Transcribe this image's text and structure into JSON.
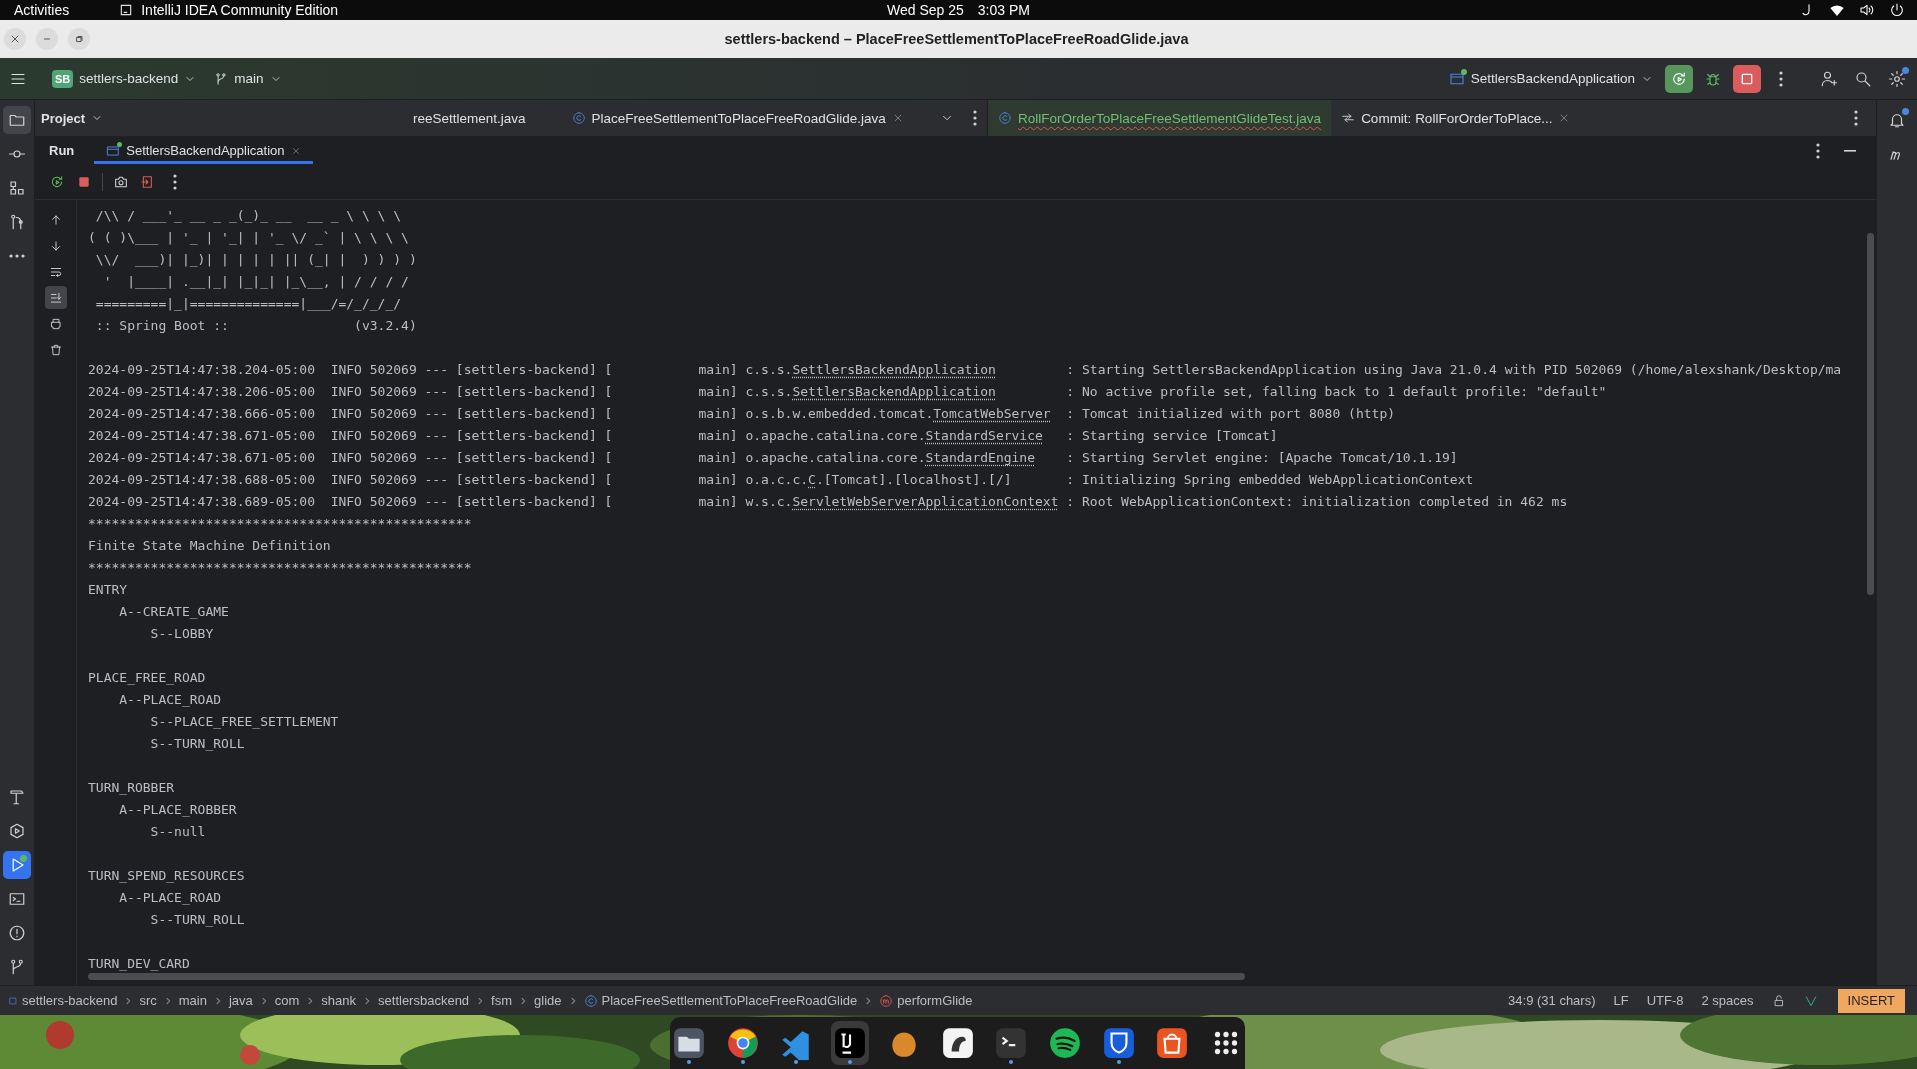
{
  "topbar": {
    "activities": "Activities",
    "app": "IntelliJ IDEA Community Edition",
    "date": "Wed Sep 25",
    "time": "3:03 PM"
  },
  "window": {
    "title": "settlers-backend – PlaceFreeSettlementToPlaceFreeRoadGlide.java"
  },
  "toolbar": {
    "project_badge": "SB",
    "project": "settlers-backend",
    "branch": "main",
    "run_config": "SettlersBackendApplication",
    "run_config_running": true,
    "settings_badge": true
  },
  "left_stripe": [
    {
      "kind": "folder",
      "selected": true,
      "focused": false,
      "running": false
    },
    {
      "kind": "commit",
      "selected": false,
      "focused": false,
      "running": false
    },
    {
      "kind": "structure",
      "selected": false,
      "focused": false,
      "running": false
    },
    {
      "kind": "pullreq",
      "selected": false,
      "focused": false,
      "running": false
    },
    {
      "kind": "more",
      "selected": false,
      "focused": false,
      "running": false
    },
    {
      "kind": "hammer",
      "selected": false,
      "focused": false,
      "running": false
    },
    {
      "kind": "services",
      "selected": false,
      "focused": false,
      "running": false
    },
    {
      "kind": "run",
      "selected": true,
      "focused": true,
      "running": true
    },
    {
      "kind": "terminal",
      "selected": false,
      "focused": false,
      "running": false
    },
    {
      "kind": "problems",
      "selected": false,
      "focused": false,
      "running": false
    },
    {
      "kind": "git",
      "selected": false,
      "focused": false,
      "running": false
    }
  ],
  "right_stripe": {
    "notifications_badge": true
  },
  "project_panel": {
    "title": "Project"
  },
  "editor_tabs": [
    {
      "label": "reeSettlement.java",
      "kind": "plain",
      "selected": false,
      "closable": false,
      "error": false
    },
    {
      "label": "PlaceFreeSettlementToPlaceFreeRoadGlide.java",
      "kind": "class",
      "selected": false,
      "closable": true,
      "error": false
    }
  ],
  "split_tabs": [
    {
      "label": "RollForOrderToPlaceFreeSettlementGlideTest.java",
      "kind": "test",
      "selected": true,
      "closable": false,
      "error": true
    },
    {
      "label": "Commit: RollForOrderToPlace...",
      "kind": "commit",
      "selected": false,
      "closable": true,
      "error": false
    }
  ],
  "run_panel": {
    "title": "Run",
    "tabs": [
      {
        "label": "SettlersBackendApplication",
        "selected": true,
        "closable": true
      }
    ]
  },
  "gutter": [
    {
      "kind": "up",
      "selected": false
    },
    {
      "kind": "down",
      "selected": false
    },
    {
      "kind": "wrap",
      "selected": false
    },
    {
      "kind": "scrollend",
      "selected": true
    },
    {
      "kind": "print",
      "selected": false
    },
    {
      "kind": "trash",
      "selected": false
    }
  ],
  "console": {
    "banner": [
      " /\\\\ / ___'_ __ _ _(_)_ __  __ _ \\ \\ \\ \\",
      "( ( )\\___ | '_ | '_| | '_ \\/ _` | \\ \\ \\ \\",
      " \\\\/  ___)| |_)| | | | | || (_| |  ) ) ) )",
      "  '  |____| .__|_| |_|_| |_\\__, | / / / /",
      " =========|_|==============|___/=/_/_/_/",
      " :: Spring Boot ::                (v3.2.4)"
    ],
    "log": [
      {
        "prefix": "2024-09-25T14:47:38.204-05:00  INFO 502069 --- [settlers-backend] [           main] ",
        "package": "c.s.s.",
        "class": "SettlersBackendApplication",
        "message": ": Starting SettlersBackendApplication using Java 21.0.4 with PID 502069 (/home/alexshank/Desktop/ma"
      },
      {
        "prefix": "2024-09-25T14:47:38.206-05:00  INFO 502069 --- [settlers-backend] [           main] ",
        "package": "c.s.s.",
        "class": "SettlersBackendApplication",
        "message": ": No active profile set, falling back to 1 default profile: \"default\""
      },
      {
        "prefix": "2024-09-25T14:47:38.666-05:00  INFO 502069 --- [settlers-backend] [           main] ",
        "package": "o.s.b.w.embedded.tomcat.",
        "class": "TomcatWebServer",
        "message": ": Tomcat initialized with port 8080 (http)"
      },
      {
        "prefix": "2024-09-25T14:47:38.671-05:00  INFO 502069 --- [settlers-backend] [           main] ",
        "package": "o.apache.catalina.core.",
        "class": "StandardService",
        "message": ": Starting service [Tomcat]"
      },
      {
        "prefix": "2024-09-25T14:47:38.671-05:00  INFO 502069 --- [settlers-backend] [           main] ",
        "package": "o.apache.catalina.core.",
        "class": "StandardEngine",
        "message": ": Starting Servlet engine: [Apache Tomcat/10.1.19]"
      },
      {
        "prefix": "2024-09-25T14:47:38.688-05:00  INFO 502069 --- [settlers-backend] [           main] ",
        "package": "o.a.c.c.",
        "class": "C",
        "suffix": ".[Tomcat].[localhost].[/]",
        "message": ": Initializing Spring embedded WebApplicationContext"
      },
      {
        "prefix": "2024-09-25T14:47:38.689-05:00  INFO 502069 --- [settlers-backend] [           main] ",
        "package": "w.s.c.",
        "class": "ServletWebServerApplicationContext",
        "message": ": Root WebApplicationContext: initialization completed in 462 ms"
      }
    ],
    "fsm": {
      "rule_top": "*************************************************",
      "title": "Finite State Machine Definition",
      "rule_bottom": "*************************************************",
      "states": [
        {
          "label": "ENTRY",
          "children": [
            {
              "label": "A--CREATE_GAME",
              "children": [
                {
                  "label": "S--LOBBY"
                }
              ]
            }
          ]
        },
        {
          "label": "PLACE_FREE_ROAD",
          "children": [
            {
              "label": "A--PLACE_ROAD",
              "children": [
                {
                  "label": "S--PLACE_FREE_SETTLEMENT"
                },
                {
                  "label": "S--TURN_ROLL"
                }
              ]
            }
          ]
        },
        {
          "label": "TURN_ROBBER",
          "children": [
            {
              "label": "A--PLACE_ROBBER",
              "children": [
                {
                  "label": "S--null"
                }
              ]
            }
          ]
        },
        {
          "label": "TURN_SPEND_RESOURCES",
          "children": [
            {
              "label": "A--PLACE_ROAD",
              "children": [
                {
                  "label": "S--TURN_ROLL"
                }
              ]
            }
          ]
        },
        {
          "label": "TURN_DEV_CARD"
        }
      ]
    }
  },
  "status_bar": {
    "breadcrumbs": [
      {
        "label": "settlers-backend",
        "kind": "module"
      },
      {
        "label": "src",
        "kind": "folder"
      },
      {
        "label": "main",
        "kind": "folder"
      },
      {
        "label": "java",
        "kind": "folder"
      },
      {
        "label": "com",
        "kind": "folder"
      },
      {
        "label": "shank",
        "kind": "folder"
      },
      {
        "label": "settlersbackend",
        "kind": "folder"
      },
      {
        "label": "fsm",
        "kind": "folder"
      },
      {
        "label": "glide",
        "kind": "folder"
      },
      {
        "label": "PlaceFreeSettlementToPlaceFreeRoadGlide",
        "kind": "class"
      },
      {
        "label": "performGlide",
        "kind": "method"
      }
    ],
    "position": "34:9 (31 chars)",
    "line_ending": "LF",
    "encoding": "UTF-8",
    "indent": "2 spaces",
    "mode": "INSERT"
  },
  "dock": [
    {
      "kind": "files",
      "running": true
    },
    {
      "kind": "browser",
      "running": true
    },
    {
      "kind": "editor",
      "running": true
    },
    {
      "kind": "ide",
      "running": true
    },
    {
      "kind": "dog",
      "running": false
    },
    {
      "kind": "drawing",
      "running": false
    },
    {
      "kind": "terminal",
      "running": true
    },
    {
      "kind": "music",
      "running": false
    },
    {
      "kind": "shield",
      "running": true
    },
    {
      "kind": "store",
      "running": false
    },
    {
      "kind": "apps",
      "running": false
    }
  ]
}
